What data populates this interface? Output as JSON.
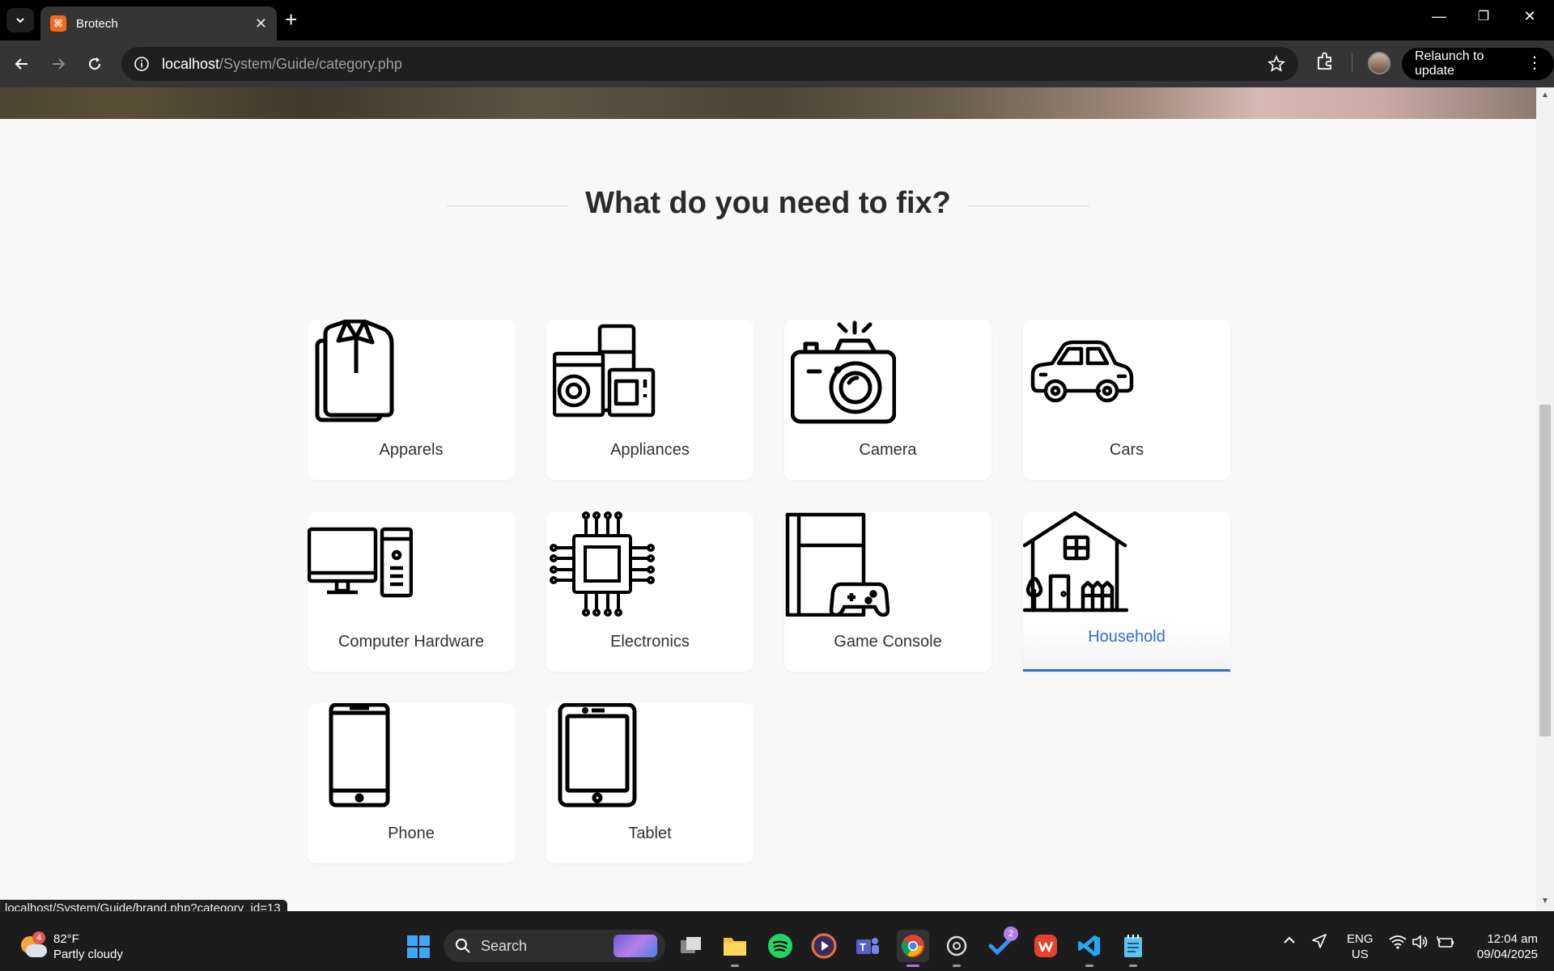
{
  "browser": {
    "tab_title": "Brotech",
    "url_host": "localhost",
    "url_path": "/System/Guide/category.php",
    "relaunch_label": "Relaunch to update",
    "status_url": "localhost/System/Guide/brand.php?category_id=13"
  },
  "page": {
    "heading": "What do you need to fix?",
    "accent_color": "#2f6fd1",
    "categories": [
      {
        "label": "Apparels",
        "icon": "shirt-icon"
      },
      {
        "label": "Appliances",
        "icon": "appliances-icon"
      },
      {
        "label": "Camera",
        "icon": "camera-icon"
      },
      {
        "label": "Cars",
        "icon": "car-icon"
      },
      {
        "label": "Computer Hardware",
        "icon": "desktop-computer-icon"
      },
      {
        "label": "Electronics",
        "icon": "chip-icon"
      },
      {
        "label": "Game Console",
        "icon": "game-console-icon"
      },
      {
        "label": "Household",
        "icon": "house-icon",
        "state": "hover"
      },
      {
        "label": "Phone",
        "icon": "phone-icon"
      },
      {
        "label": "Tablet",
        "icon": "tablet-icon"
      }
    ]
  },
  "taskbar": {
    "weather_temp": "82°F",
    "weather_desc": "Partly cloudy",
    "weather_badge": "4",
    "search_label": "Search",
    "todo_badge": "2",
    "lang_line1": "ENG",
    "lang_line2": "US",
    "time": "12:04 am",
    "date": "09/04/2025"
  }
}
